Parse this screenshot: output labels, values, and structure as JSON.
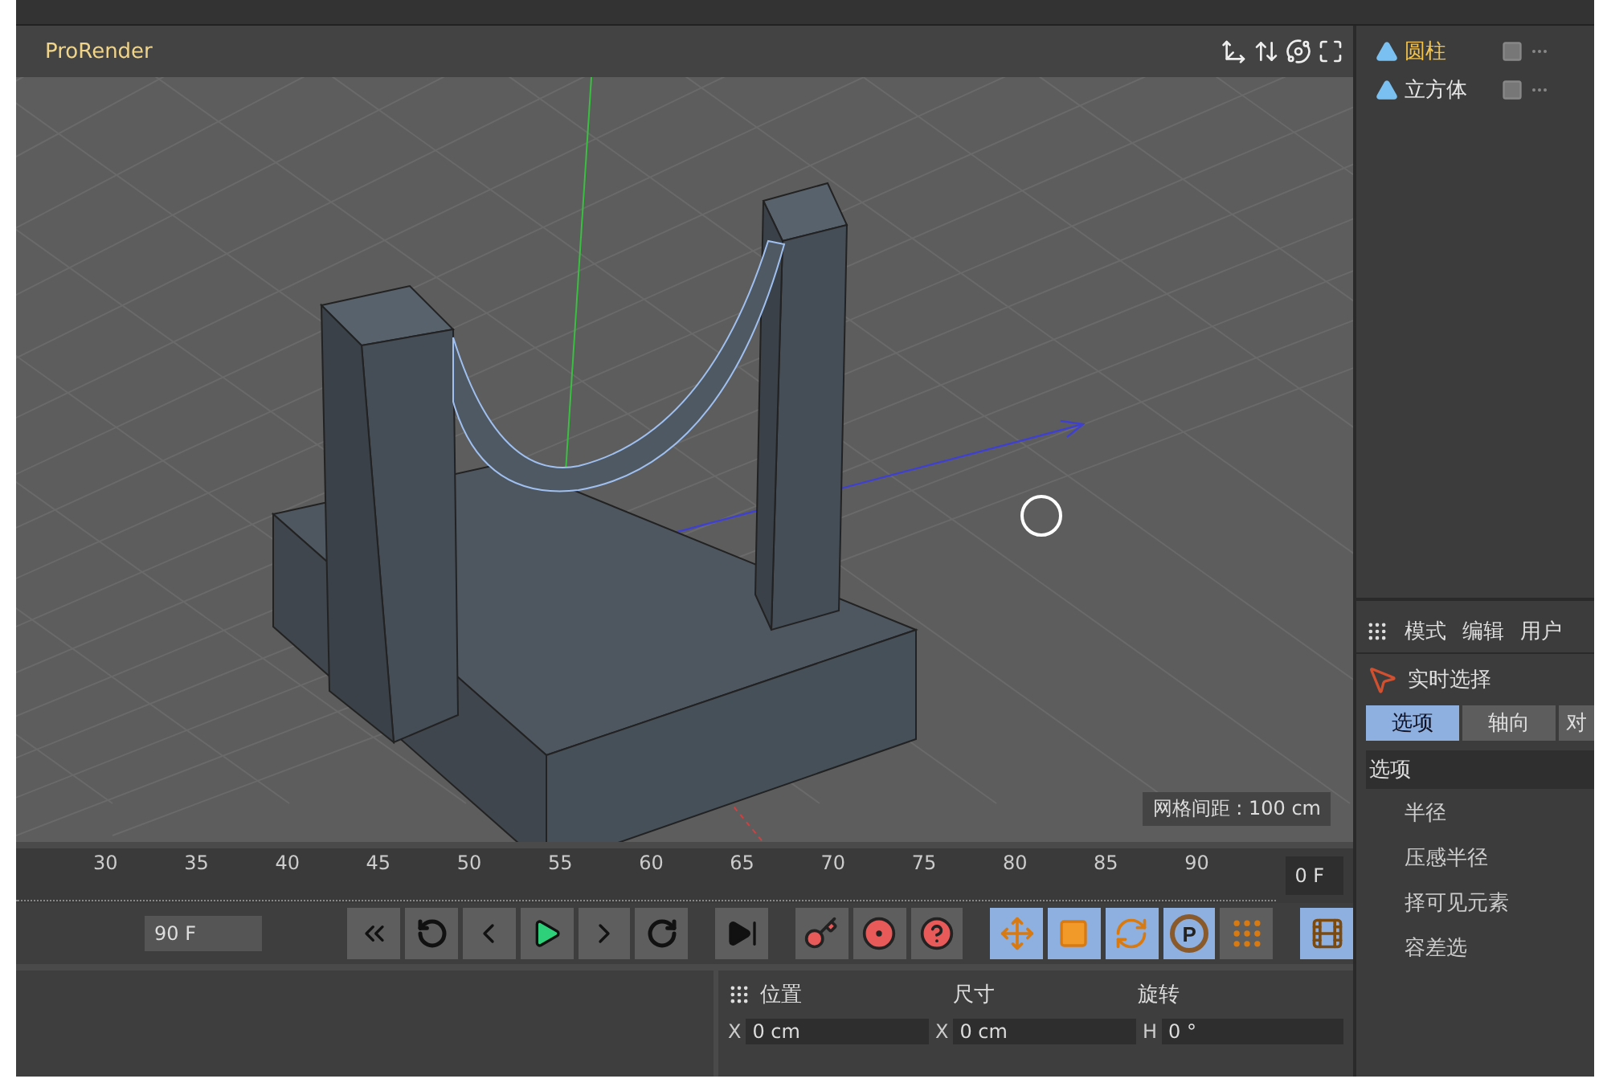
{
  "viewport": {
    "title": "ProRender",
    "grid_spacing": "网格间距 : 100 cm"
  },
  "objects": [
    {
      "name": "圆柱",
      "selected": true
    },
    {
      "name": "立方体",
      "selected": false
    }
  ],
  "attributes": {
    "menu": [
      "模式",
      "编辑",
      "用户"
    ],
    "tool": "实时选择",
    "tabs": [
      {
        "label": "选项",
        "selected": true
      },
      {
        "label": "轴向",
        "selected": false
      },
      {
        "label": "对",
        "selected": false
      }
    ],
    "section": "选项",
    "fields": [
      "半径",
      "压感半径",
      "择可见元素",
      "容差选"
    ]
  },
  "timeline": {
    "ticks": [
      "30",
      "35",
      "40",
      "45",
      "50",
      "55",
      "60",
      "65",
      "70",
      "75",
      "80",
      "85",
      "90"
    ],
    "current_frame": "0 F",
    "end_frame": "90 F"
  },
  "transport": [
    {
      "kind": "first",
      "on": false
    },
    {
      "kind": "loop-back",
      "on": false
    },
    {
      "kind": "prev",
      "on": false
    },
    {
      "kind": "play",
      "on": false
    },
    {
      "kind": "next",
      "on": false
    },
    {
      "kind": "loop-fwd",
      "on": false
    },
    {
      "kind": "last",
      "on": false
    },
    {
      "kind": "key",
      "on": false
    },
    {
      "kind": "autokey",
      "on": false
    },
    {
      "kind": "help",
      "on": false
    },
    {
      "kind": "move",
      "on": true
    },
    {
      "kind": "scale",
      "on": true
    },
    {
      "kind": "rotate",
      "on": true
    },
    {
      "kind": "param",
      "on": true,
      "label": "P"
    },
    {
      "kind": "dots",
      "on": false
    },
    {
      "kind": "film",
      "on": true
    }
  ],
  "coordinates": {
    "headers": [
      "位置",
      "尺寸",
      "旋转"
    ],
    "fields": [
      {
        "axis": "X",
        "value": "0 cm"
      },
      {
        "axis": "X",
        "value": "0 cm"
      },
      {
        "axis": "H",
        "value": "0 °"
      }
    ]
  }
}
